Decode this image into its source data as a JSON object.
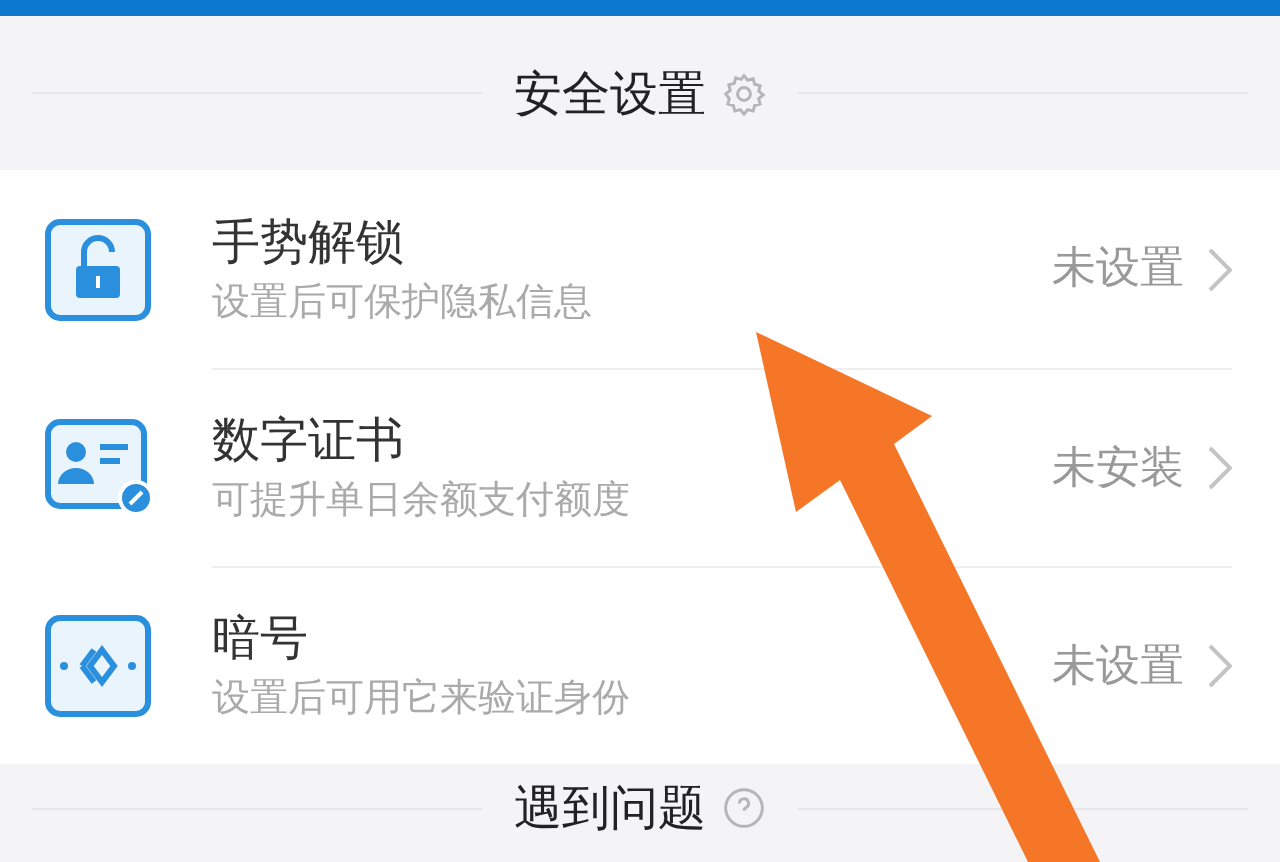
{
  "sections": [
    {
      "title": "安全设置",
      "items": [
        {
          "title": "手势解锁",
          "subtitle": "设置后可保护隐私信息",
          "status": "未设置"
        },
        {
          "title": "数字证书",
          "subtitle": "可提升单日余额支付额度",
          "status": "未安装"
        },
        {
          "title": "暗号",
          "subtitle": "设置后可用它来验证身份",
          "status": "未设置"
        }
      ]
    },
    {
      "title": "遇到问题"
    }
  ]
}
